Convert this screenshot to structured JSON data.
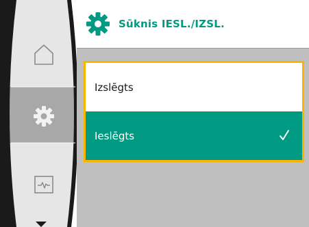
{
  "header": {
    "title": "Sūknis IESL./IZSL.",
    "icon": "gear-icon"
  },
  "sidebar": {
    "items": [
      {
        "icon": "home-icon",
        "state": "inactive"
      },
      {
        "icon": "gear-icon",
        "state": "active"
      },
      {
        "icon": "diagnostics-icon",
        "state": "inactive"
      }
    ],
    "more_indicator": "chevron-down-icon"
  },
  "options": [
    {
      "label": "Izslēgts",
      "selected": false
    },
    {
      "label": "Ieslēgts",
      "selected": true
    }
  ],
  "colors": {
    "accent": "#009a82",
    "focus_frame": "#f7b500",
    "content_bg": "#bfbfbf",
    "sidebar_bg": "#e6e6e6",
    "sidebar_active": "#a8a8a8",
    "sidebar_ring": "#1a1a1a"
  }
}
